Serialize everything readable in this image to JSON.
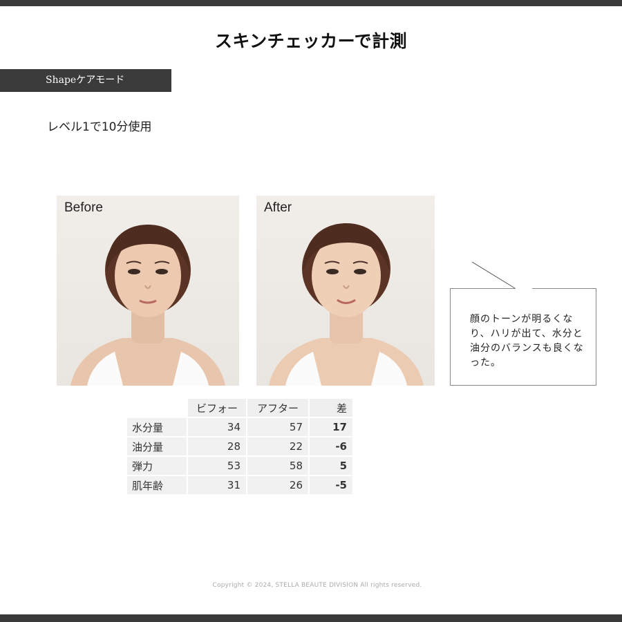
{
  "page": {
    "title": "スキンチェッカーで計測",
    "mode_label": "Shapeケアモード",
    "usage": "レベル1で10分使用",
    "copyright": "Copyright © 2024, STELLA BEAUTE DIVISION All rights reserved."
  },
  "photos": {
    "before_label": "Before",
    "after_label": "After"
  },
  "comment": {
    "text": "顔のトーンが明るくなり、ハリが出て、水分と油分のバランスも良くなった。"
  },
  "table": {
    "headers": [
      "",
      "ビフォー",
      "アフター",
      "差"
    ],
    "rows": [
      {
        "label": "水分量",
        "before": "34",
        "after": "57",
        "diff": "17",
        "sign": "pos"
      },
      {
        "label": "油分量",
        "before": "28",
        "after": "22",
        "diff": "-6",
        "sign": "neg"
      },
      {
        "label": "弾力",
        "before": "53",
        "after": "58",
        "diff": "5",
        "sign": "pos"
      },
      {
        "label": "肌年齢",
        "before": "31",
        "after": "26",
        "diff": "-5",
        "sign": "neg"
      }
    ]
  },
  "colors": {
    "positive": "#1f4a8f",
    "negative": "#c0221c",
    "bars": "#3a3a3a"
  }
}
